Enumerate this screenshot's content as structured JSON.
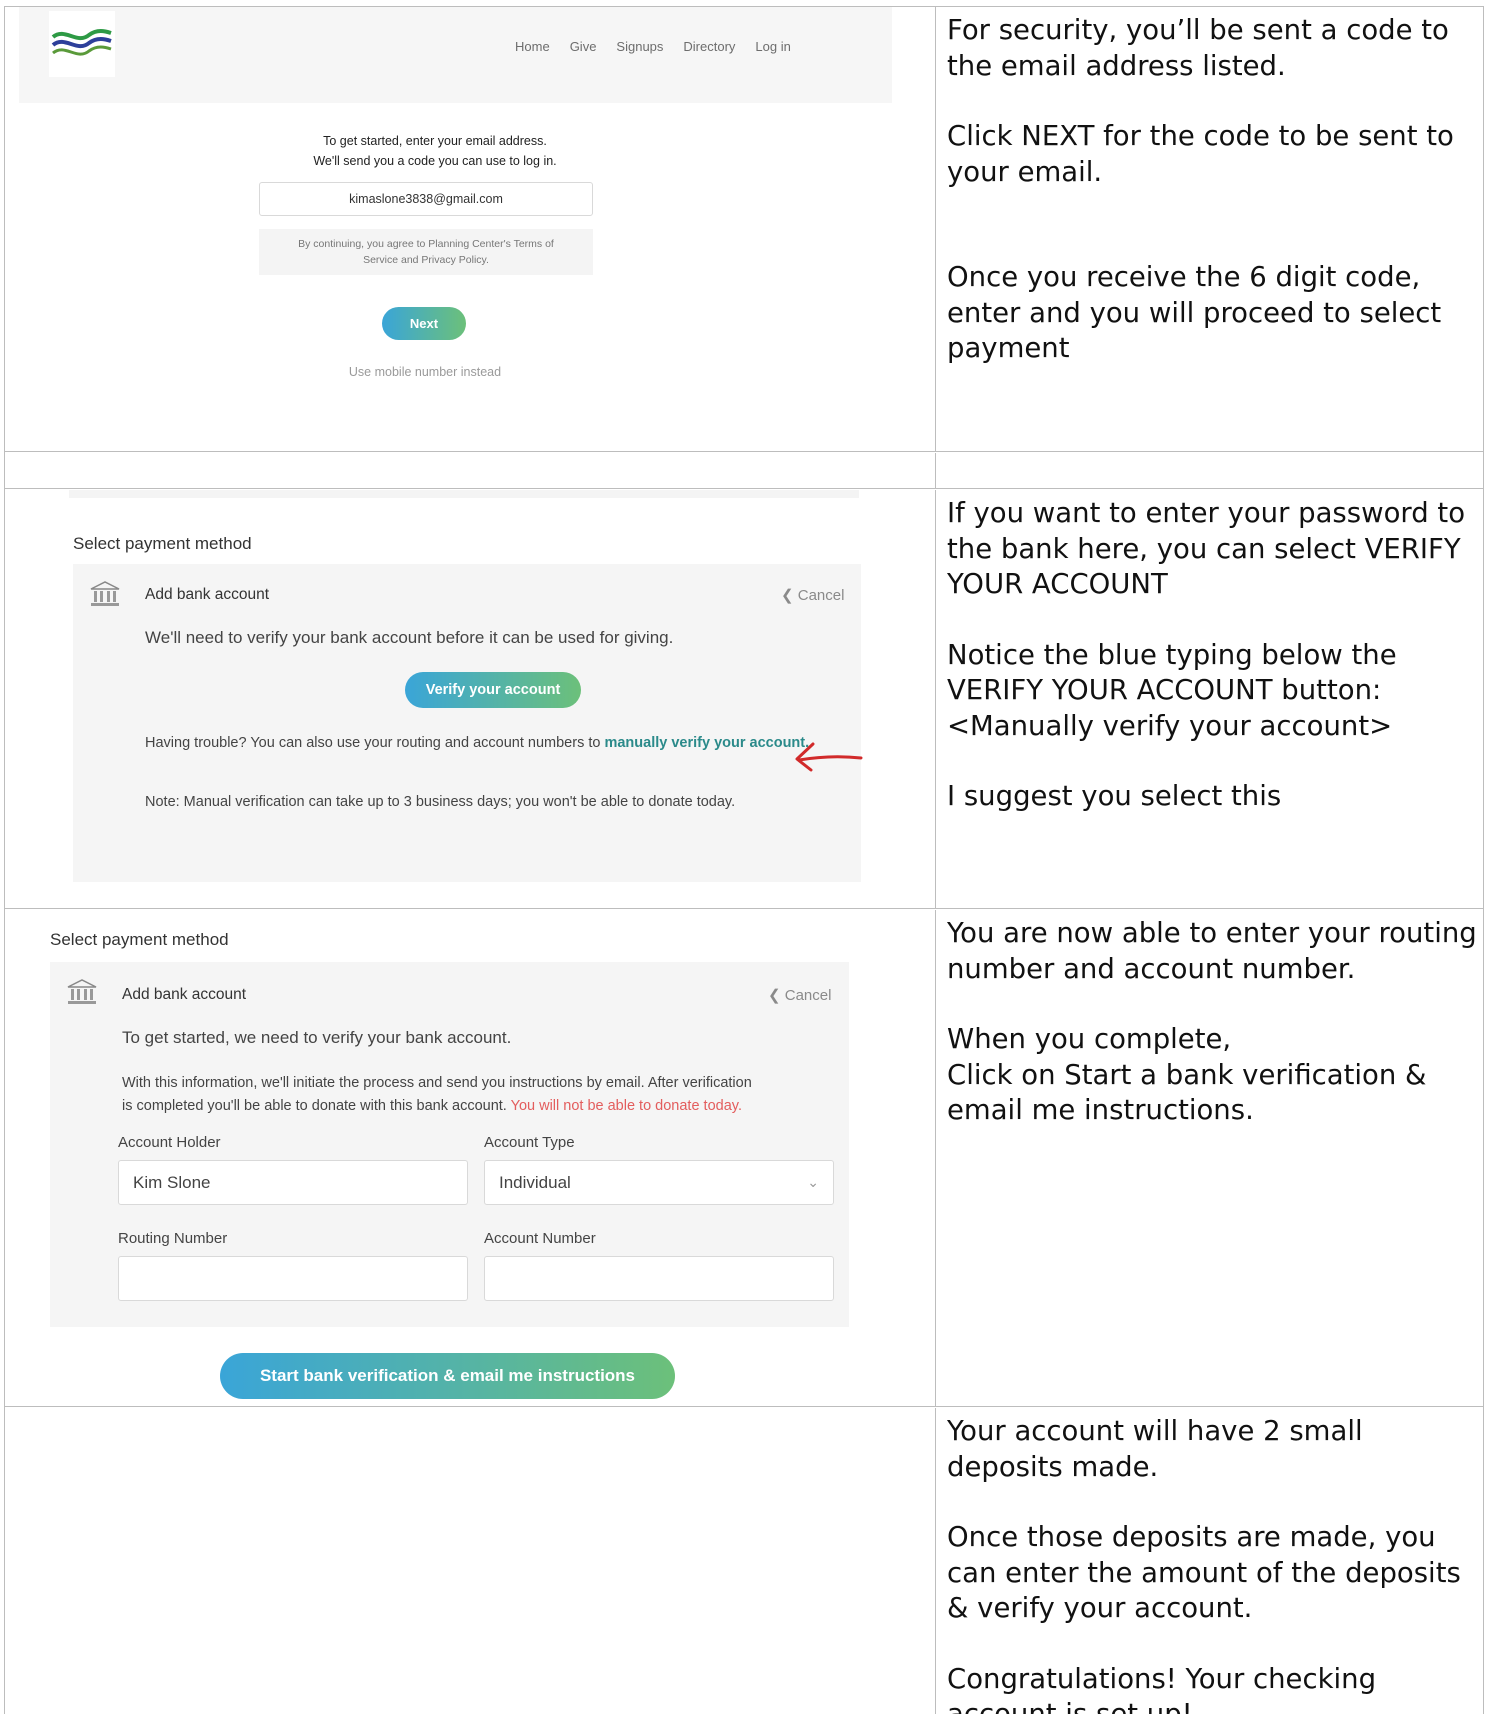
{
  "step1": {
    "nav": [
      "Home",
      "Give",
      "Signups",
      "Directory",
      "Log in"
    ],
    "intro_line1": "To get started, enter your email address.",
    "intro_line2": "We'll send you a code you can use to log in.",
    "email_value": "kimaslone3838@gmail.com",
    "terms_line1": "By continuing, you agree to Planning Center's Terms of",
    "terms_line2": "Service and Privacy Policy.",
    "next_label": "Next",
    "mobile_link": "Use mobile number instead",
    "instructions": [
      "For security, you’ll be sent a code to the email address listed.",
      "Click NEXT for the code to be sent to your email.",
      "Once you receive the 6 digit code, enter and you will proceed to select payment"
    ]
  },
  "step2": {
    "title": "Select payment method",
    "panel_title": "Add bank account",
    "cancel": "Cancel",
    "verify_intro": "We'll need to verify your bank account before it can be used for giving.",
    "verify_button": "Verify your account",
    "trouble_prefix": "Having trouble? You can also use your routing and account numbers to ",
    "trouble_link": "manually verify your account.",
    "note": "Note: Manual verification can take up to 3 business days; you won't be able to donate today.",
    "instructions": [
      "If you want to enter your password to the bank here, you can select VERIFY YOUR ACCOUNT",
      "Notice the blue typing below the VERIFY YOUR ACCOUNT button:",
      "<Manually verify your account>",
      "I suggest you select this"
    ]
  },
  "step3": {
    "title": "Select payment method",
    "panel_title": "Add bank account",
    "cancel": "Cancel",
    "get_started": "To get started, we need to verify your bank account.",
    "info_line1": "With this information, we'll initiate the process and send you instructions by email. After verification",
    "info_line2_prefix": "is completed you'll be able to donate with this bank account. ",
    "info_line2_red": "You will not be able to donate today.",
    "account_holder_label": "Account Holder",
    "account_holder_value": "Kim Slone",
    "account_type_label": "Account Type",
    "account_type_value": "Individual",
    "routing_label": "Routing Number",
    "account_number_label": "Account Number",
    "start_button": "Start bank verification & email me instructions",
    "instructions": [
      "You are now able to enter your routing number and account number.",
      "When you complete,",
      "Click on Start a bank verification & email me instructions."
    ]
  },
  "step4": {
    "instructions": [
      "Your account will have 2 small deposits made.",
      "Once those deposits are made, you can enter the amount of the deposits & verify your account.",
      "Congratulations! Your checking account is set up!"
    ]
  }
}
